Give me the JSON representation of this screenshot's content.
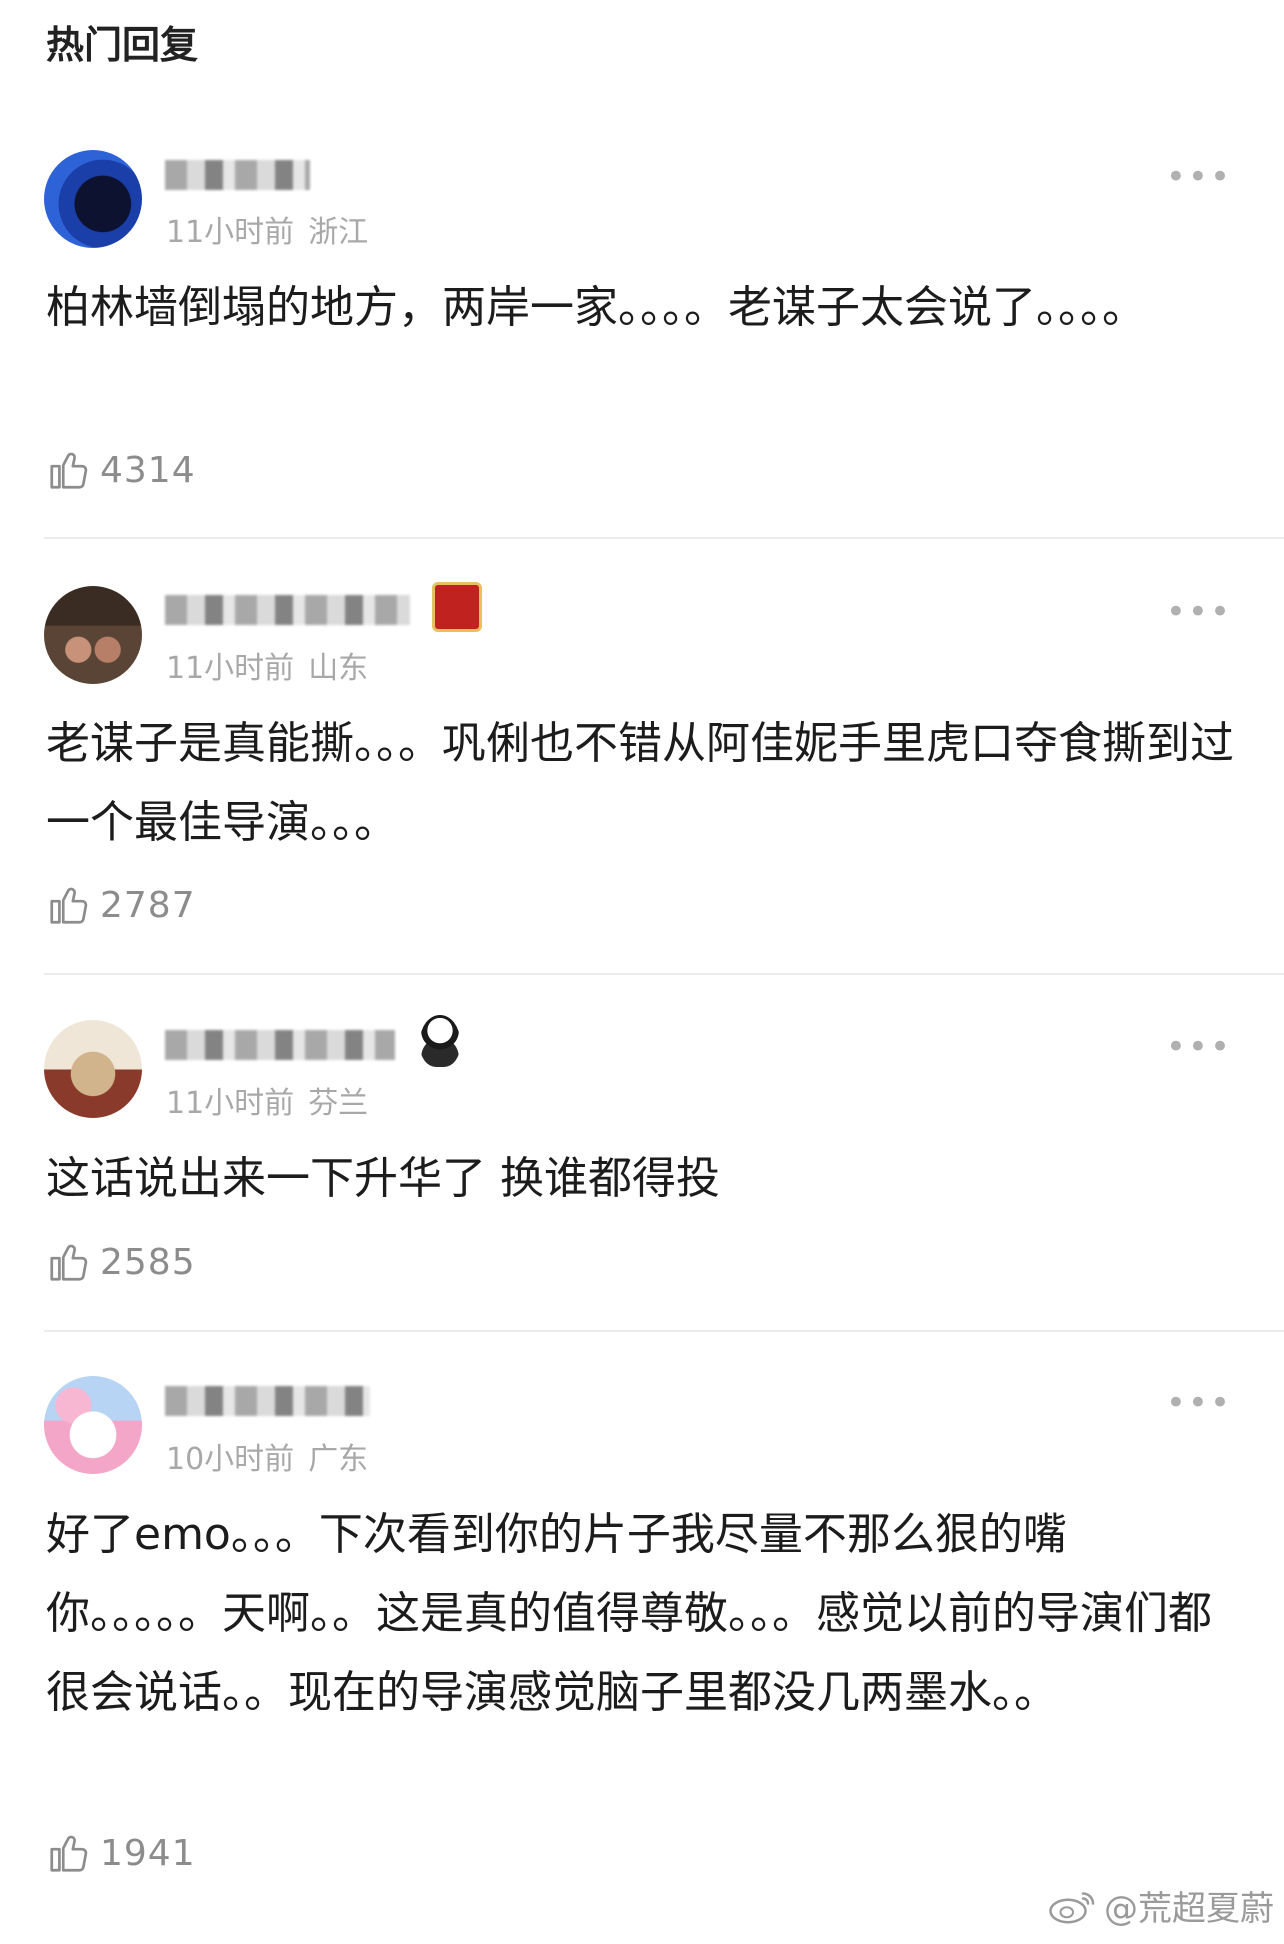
{
  "header": {
    "title": "热门回复"
  },
  "comments": [
    {
      "time": "11小时前",
      "location": "浙江",
      "text": "柏林墙倒塌的地方，两岸一家。。。。老谋子太会说了。。。。",
      "likes": "4314"
    },
    {
      "time": "11小时前",
      "location": "山东",
      "text": "老谋子是真能撕。。。巩俐也不错从阿佳妮手里虎口夺食撕到过一个最佳导演。。。",
      "likes": "2787"
    },
    {
      "time": "11小时前",
      "location": "芬兰",
      "text": "这话说出来一下升华了 换谁都得投",
      "likes": "2585"
    },
    {
      "time": "10小时前",
      "location": "广东",
      "text": "好了emo。。。下次看到你的片子我尽量不那么狠的嘴你。。。。。天啊。。这是真的值得尊敬。。。感觉以前的导演们都很会说话。。现在的导演感觉脑子里都没几两墨水。。",
      "likes": "1941"
    }
  ],
  "more_label": "•••",
  "watermark": {
    "text": "@荒超夏蔚"
  },
  "icons": {
    "like": "thumbs-up-icon",
    "more": "more-dots-icon",
    "weibo": "weibo-logo-icon"
  },
  "colors": {
    "meta": "#a8a8a8",
    "likes": "#8c8c8c",
    "divider": "#ececec"
  }
}
